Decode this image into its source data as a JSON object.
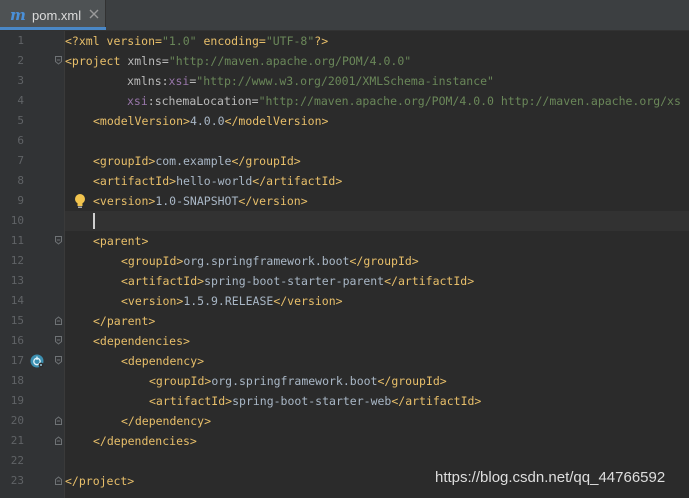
{
  "tab": {
    "icon_letter": "m",
    "label": "pom.xml"
  },
  "line_numbers": [
    "1",
    "2",
    "3",
    "4",
    "5",
    "6",
    "7",
    "8",
    "9",
    "10",
    "11",
    "12",
    "13",
    "14",
    "15",
    "16",
    "17",
    "18",
    "19",
    "20",
    "21",
    "22",
    "23"
  ],
  "code": {
    "l1": {
      "p1": "<?xml version=",
      "v1": "\"1.0\"",
      "p2": " encoding=",
      "v2": "\"UTF-8\"",
      "p3": "?>"
    },
    "l2": {
      "t1": "<project ",
      "a1": "xmlns=",
      "v1": "\"http://maven.apache.org/POM/4.0.0\""
    },
    "l3": {
      "a1": "xmlns:",
      "n1": "xsi",
      "a2": "=",
      "v1": "\"http://www.w3.org/2001/XMLSchema-instance\""
    },
    "l4": {
      "n1": "xsi",
      "a1": ":schemaLocation=",
      "v1": "\"http://maven.apache.org/POM/4.0.0 http://maven.apache.org/xs"
    },
    "l5": {
      "t1": "<modelVersion>",
      "x1": "4.0.0",
      "t2": "</modelVersion>"
    },
    "l7": {
      "t1": "<groupId>",
      "x1": "com.example",
      "t2": "</groupId>"
    },
    "l8": {
      "t1": "<artifactId>",
      "x1": "hello-world",
      "t2": "</artifactId>"
    },
    "l9": {
      "t1": "<version>",
      "x1": "1.0-SNAPSHOT",
      "t2": "</version>"
    },
    "l11": {
      "t1": "<parent>"
    },
    "l12": {
      "t1": "<groupId>",
      "x1": "org.springframework.boot",
      "t2": "</groupId>"
    },
    "l13": {
      "t1": "<artifactId>",
      "x1": "spring-boot-starter-parent",
      "t2": "</artifactId>"
    },
    "l14": {
      "t1": "<version>",
      "x1": "1.5.9.RELEASE",
      "t2": "</version>"
    },
    "l15": {
      "t1": "</parent>"
    },
    "l16": {
      "t1": "<dependencies>"
    },
    "l17": {
      "t1": "<dependency>"
    },
    "l18": {
      "t1": "<groupId>",
      "x1": "org.springframework.boot",
      "t2": "</groupId>"
    },
    "l19": {
      "t1": "<artifactId>",
      "x1": "spring-boot-starter-web",
      "t2": "</artifactId>"
    },
    "l20": {
      "t1": "</dependency>"
    },
    "l21": {
      "t1": "</dependencies>"
    },
    "l23": {
      "t1": "</project>"
    }
  },
  "watermark": "https://blog.csdn.net/qq_44766592",
  "colors": {
    "editor_bg": "#2b2b2b",
    "gutter_bg": "#313335",
    "tag": "#e8bf6a",
    "attribute": "#bababa",
    "string_value": "#6a8759",
    "namespace": "#9876aa",
    "text": "#a9b7c6",
    "line_number": "#606366"
  },
  "icons": {
    "tab_icon": "maven-m-icon",
    "tab_close": "close-icon",
    "fold": "fold-marker-icon",
    "intention": "lightbulb-icon",
    "gutter_spring": "spring-boot-icon"
  }
}
